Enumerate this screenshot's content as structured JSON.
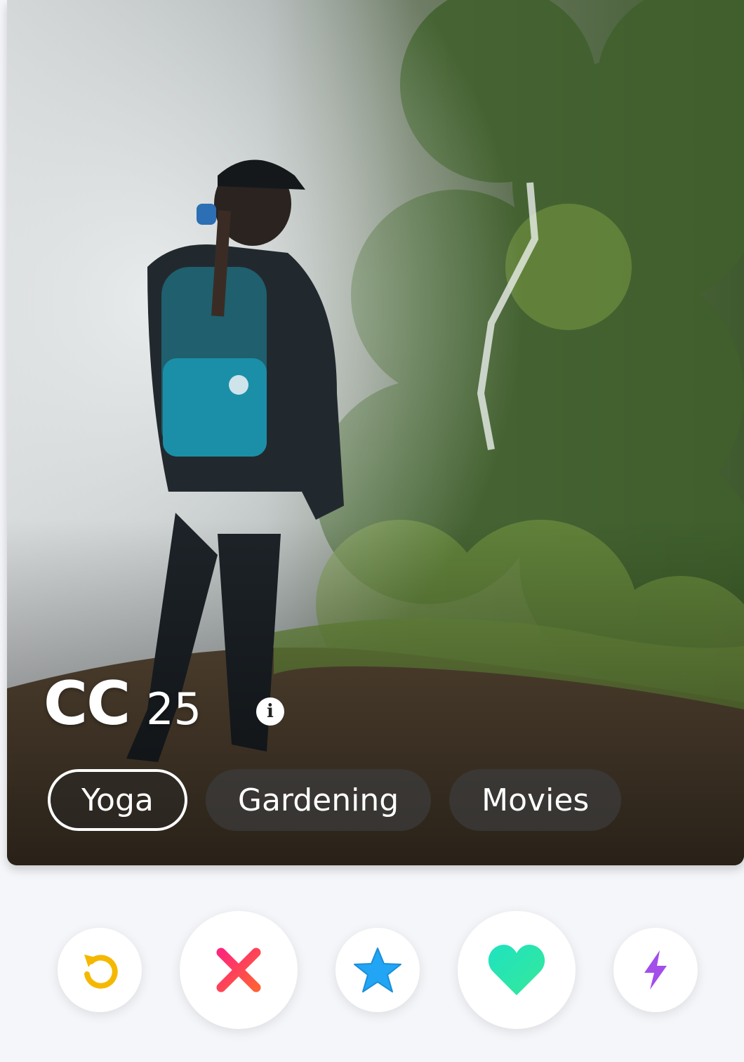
{
  "profile": {
    "name": "CC",
    "age": "25",
    "info_icon": "info-icon"
  },
  "interests": [
    {
      "label": "Yoga",
      "selected": true
    },
    {
      "label": "Gardening",
      "selected": false
    },
    {
      "label": "Movies",
      "selected": false
    }
  ],
  "actions": [
    {
      "name": "rewind",
      "icon": "rewind-icon",
      "color": "#f5b800"
    },
    {
      "name": "nope",
      "icon": "close-icon",
      "color": "#fd4f6e"
    },
    {
      "name": "super-like",
      "icon": "star-icon",
      "color": "#21a5f4"
    },
    {
      "name": "like",
      "icon": "heart-icon",
      "color": "#2ee8b0"
    },
    {
      "name": "boost",
      "icon": "bolt-icon",
      "color": "#a34dea"
    }
  ]
}
